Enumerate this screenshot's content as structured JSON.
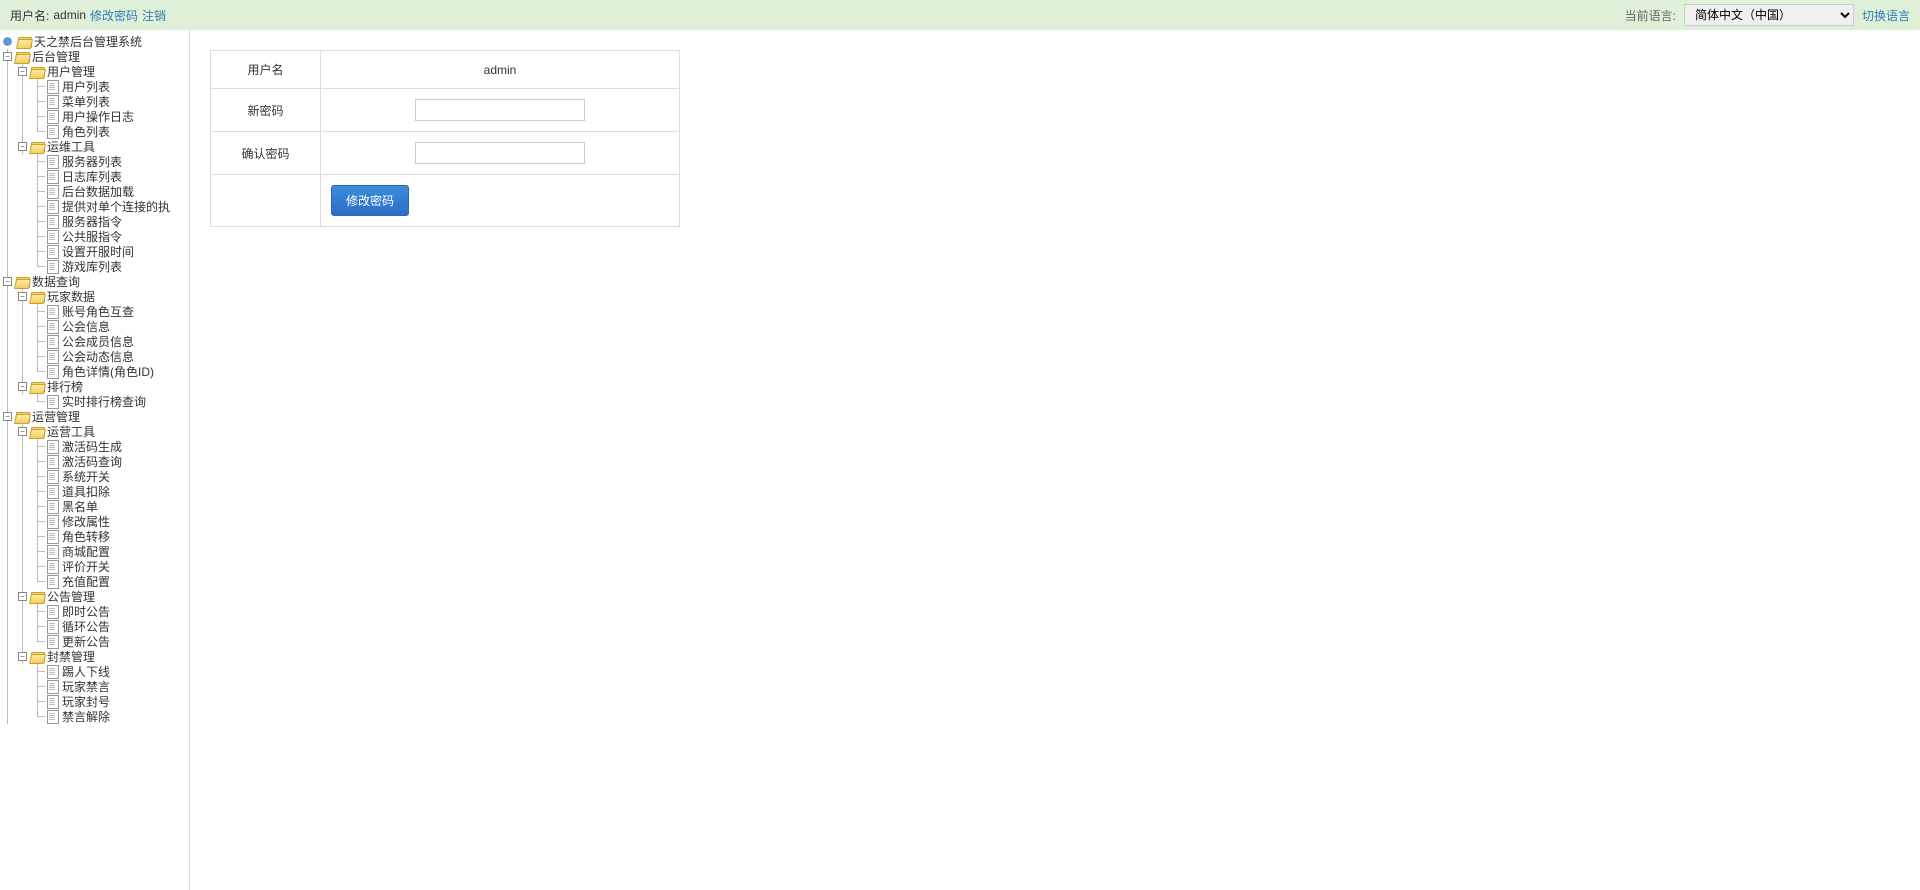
{
  "header": {
    "username_label": "用户名:",
    "username": "admin",
    "change_password": "修改密码",
    "logout": "注销",
    "language_label": "当前语言:",
    "language_value": "简体中文（中国）",
    "switch_language": "切换语言"
  },
  "tree": {
    "root": "天之禁后台管理系统",
    "n1": "后台管理",
    "n1_1": "用户管理",
    "n1_1_items": [
      "用户列表",
      "菜单列表",
      "用户操作日志",
      "角色列表"
    ],
    "n1_2": "运维工具",
    "n1_2_items": [
      "服务器列表",
      "日志库列表",
      "后台数据加载",
      "提供对单个连接的执",
      "服务器指令",
      "公共服指令",
      "设置开服时间",
      "游戏库列表"
    ],
    "n2": "数据查询",
    "n2_1": "玩家数据",
    "n2_1_items": [
      "账号角色互查",
      "公会信息",
      "公会成员信息",
      "公会动态信息",
      "角色详情(角色ID)"
    ],
    "n2_2": "排行榜",
    "n2_2_items": [
      "实时排行榜查询"
    ],
    "n3": "运营管理",
    "n3_1": "运营工具",
    "n3_1_items": [
      "激活码生成",
      "激活码查询",
      "系统开关",
      "道具扣除",
      "黑名单",
      "修改属性",
      "角色转移",
      "商城配置",
      "评价开关",
      "充值配置"
    ],
    "n3_2": "公告管理",
    "n3_2_items": [
      "即时公告",
      "循环公告",
      "更新公告"
    ],
    "n3_3": "封禁管理",
    "n3_3_items": [
      "踢人下线",
      "玩家禁言",
      "玩家封号",
      "禁言解除"
    ]
  },
  "form": {
    "username_label": "用户名",
    "username_value": "admin",
    "new_password": "新密码",
    "confirm_password": "确认密码",
    "submit": "修改密码"
  }
}
